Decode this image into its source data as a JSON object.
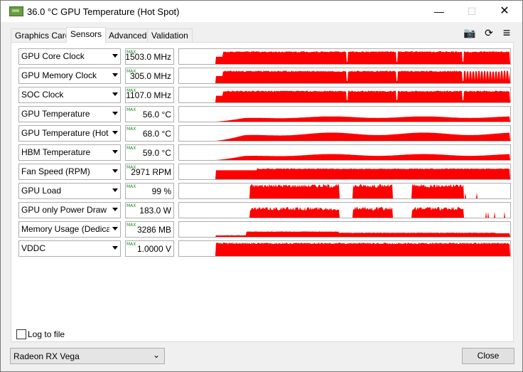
{
  "window": {
    "title": "36.0 °C GPU Temperature (Hot Spot)",
    "min_glyph": "—",
    "max_glyph": "☐",
    "close_glyph": "✕"
  },
  "tabs": [
    {
      "label": "Graphics Card",
      "active": false
    },
    {
      "label": "Sensors",
      "active": true
    },
    {
      "label": "Advanced",
      "active": false
    },
    {
      "label": "Validation",
      "active": false
    }
  ],
  "toolbar": {
    "camera_glyph": "📷",
    "refresh_glyph": "⟳",
    "menu_glyph": "≡"
  },
  "colors": {
    "graph": "#ff0000",
    "max_tag": "#1a8a1a"
  },
  "sensors": [
    {
      "name": "GPU Core Clock",
      "max_tag": "MAX",
      "value": "1503.0 MHz",
      "graph_style": "blocks",
      "level": 0.82
    },
    {
      "name": "GPU Memory Clock",
      "max_tag": "MAX",
      "value": "305.0 MHz",
      "graph_style": "blocks-spiky",
      "level": 0.8
    },
    {
      "name": "SOC Clock",
      "max_tag": "MAX",
      "value": "1107.0 MHz",
      "graph_style": "blocks",
      "level": 0.75
    },
    {
      "name": "GPU Temperature",
      "max_tag": "MAX",
      "value": "56.0 °C",
      "graph_style": "smooth",
      "level": 0.35
    },
    {
      "name": "GPU Temperature (Hot Spot)",
      "max_tag": "MAX",
      "value": "68.0 °C",
      "graph_style": "smooth",
      "level": 0.55
    },
    {
      "name": "HBM Temperature",
      "max_tag": "MAX",
      "value": "59.0 °C",
      "graph_style": "smooth",
      "level": 0.4
    },
    {
      "name": "Fan Speed (RPM)",
      "max_tag": "MAX",
      "value": "2971 RPM",
      "graph_style": "fan",
      "level": 0.7
    },
    {
      "name": "GPU Load",
      "max_tag": "MAX",
      "value": "99 %",
      "graph_style": "load",
      "level": 0.85
    },
    {
      "name": "GPU only Power Draw",
      "max_tag": "MAX",
      "value": "183.0 W",
      "graph_style": "load",
      "level": 0.6
    },
    {
      "name": "Memory Usage (Dedicated)",
      "max_tag": "MAX",
      "value": "3286 MB",
      "graph_style": "memory",
      "level": 0.3
    },
    {
      "name": "VDDC",
      "max_tag": "MAX",
      "value": "1.0000 V",
      "graph_style": "vddc",
      "level": 0.85
    }
  ],
  "log_to_file": {
    "label": "Log to file",
    "checked": false
  },
  "gpu_select": {
    "value": "Radeon RX Vega",
    "chevron": "⌄"
  },
  "close_button": {
    "label": "Close"
  }
}
